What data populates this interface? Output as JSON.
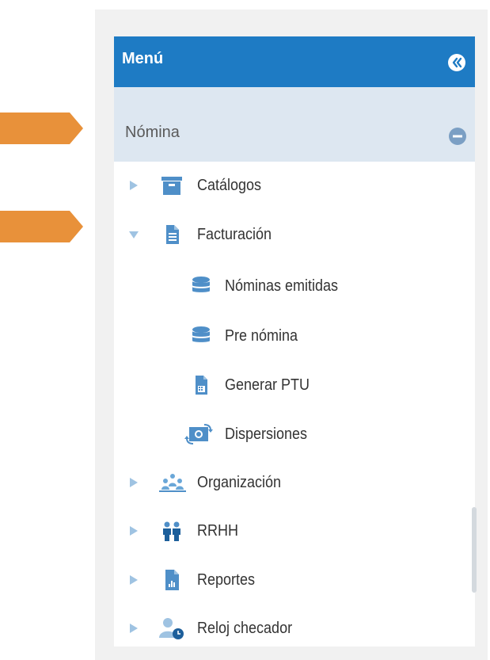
{
  "menu": {
    "title": "Menú"
  },
  "section": {
    "label": "Nómina"
  },
  "items": [
    {
      "label": "Catálogos",
      "icon": "archive-box-icon",
      "state": "collapsed"
    },
    {
      "label": "Facturación",
      "icon": "document-icon",
      "state": "expanded",
      "children": [
        {
          "label": "Nóminas emitidas",
          "icon": "database-icon"
        },
        {
          "label": "Pre nómina",
          "icon": "database-icon"
        },
        {
          "label": "Generar PTU",
          "icon": "calculator-document-icon"
        },
        {
          "label": "Dispersiones",
          "icon": "money-transfer-icon"
        }
      ]
    },
    {
      "label": "Organización",
      "icon": "organization-icon",
      "state": "collapsed"
    },
    {
      "label": "RRHH",
      "icon": "people-icon",
      "state": "collapsed"
    },
    {
      "label": "Reportes",
      "icon": "report-chart-icon",
      "state": "collapsed"
    },
    {
      "label": "Reloj checador",
      "icon": "user-clock-icon",
      "state": "collapsed"
    }
  ],
  "colors": {
    "header": "#1e7bc4",
    "section_bg": "#dde7f1",
    "icon_blue": "#4f8fc8",
    "caret": "#9fc3e2",
    "callout_arrow": "#e8913a"
  }
}
